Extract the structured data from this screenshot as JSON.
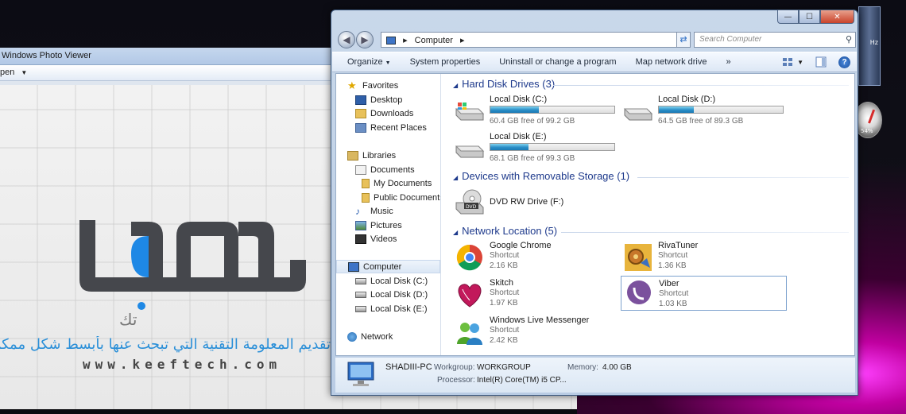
{
  "photo_viewer": {
    "title": "Windows Photo Viewer",
    "menu_open": "pen",
    "arabic_text": "تقديم المعلومة التقنية التي تبحث عنها بأبسط شكل ممكن",
    "logo_word": "كيف",
    "logo_sub": "تك",
    "url": "www.keeftech.com"
  },
  "desktop_widgets": {
    "gauge_label": "54%",
    "cpu_label": "Hz"
  },
  "explorer": {
    "caption": {
      "minimize": "—",
      "maximize": "☐",
      "close": "✕"
    },
    "address": {
      "root": "Computer",
      "separator": "▸"
    },
    "search_placeholder": "Search Computer",
    "toolbar": {
      "organize": "Organize",
      "system_properties": "System properties",
      "uninstall": "Uninstall or change a program",
      "map_network": "Map network drive",
      "more": "»"
    },
    "nav": {
      "favorites": "Favorites",
      "desktop": "Desktop",
      "downloads": "Downloads",
      "recent": "Recent Places",
      "libraries": "Libraries",
      "documents": "Documents",
      "my_documents": "My Documents",
      "public_documents": "Public Documents",
      "music": "Music",
      "pictures": "Pictures",
      "videos": "Videos",
      "computer": "Computer",
      "disk_c": "Local Disk (C:)",
      "disk_d": "Local Disk (D:)",
      "disk_e": "Local Disk (E:)",
      "network": "Network"
    },
    "groups": {
      "hdd": "Hard Disk Drives (3)",
      "removable": "Devices with Removable Storage (1)",
      "network": "Network Location (5)"
    },
    "drives": [
      {
        "name": "Local Disk (C:)",
        "free": "60.4 GB free of 99.2 GB",
        "used_fraction": 0.39
      },
      {
        "name": "Local Disk (D:)",
        "free": "64.5 GB free of 89.3 GB",
        "used_fraction": 0.28
      },
      {
        "name": "Local Disk (E:)",
        "free": "68.1 GB free of 99.3 GB",
        "used_fraction": 0.31
      }
    ],
    "dvd": {
      "name": "DVD RW Drive (F:)",
      "label": "DVD"
    },
    "shortcuts": [
      {
        "name": "Google Chrome",
        "type": "Shortcut",
        "size": "2.16 KB"
      },
      {
        "name": "RivaTuner",
        "type": "Shortcut",
        "size": "1.36 KB"
      },
      {
        "name": "Skitch",
        "type": "Shortcut",
        "size": "1.97 KB"
      },
      {
        "name": "Viber",
        "type": "Shortcut",
        "size": "1.03 KB"
      },
      {
        "name": "Windows Live Messenger",
        "type": "Shortcut",
        "size": "2.42 KB"
      }
    ],
    "details": {
      "pc_name": "SHADIII-PC",
      "workgroup_label": "Workgroup:",
      "workgroup": "WORKGROUP",
      "memory_label": "Memory:",
      "memory": "4.00 GB",
      "processor_label": "Processor:",
      "processor": "Intel(R) Core(TM) i5 CP..."
    }
  }
}
